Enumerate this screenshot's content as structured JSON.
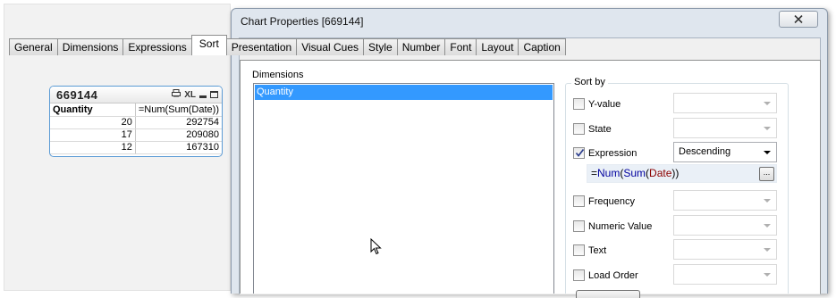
{
  "sheet": {
    "tablebox": {
      "title": "669144",
      "icons": [
        "print-icon",
        "xl-export-icon",
        "minimize-icon",
        "restore-icon"
      ],
      "xl_label": "XL",
      "columns": [
        "Quantity",
        "=Num(Sum(Date))"
      ],
      "rows": [
        [
          "20",
          "292754"
        ],
        [
          "17",
          "209080"
        ],
        [
          "12",
          "167310"
        ]
      ]
    }
  },
  "dialog": {
    "title": "Chart Properties [669144]",
    "close_icon": "close-icon",
    "tabs": [
      {
        "label": "General",
        "active": false
      },
      {
        "label": "Dimensions",
        "active": false
      },
      {
        "label": "Expressions",
        "active": false
      },
      {
        "label": "Sort",
        "active": true
      },
      {
        "label": "Presentation",
        "active": false
      },
      {
        "label": "Visual Cues",
        "active": false
      },
      {
        "label": "Style",
        "active": false
      },
      {
        "label": "Number",
        "active": false
      },
      {
        "label": "Font",
        "active": false
      },
      {
        "label": "Layout",
        "active": false
      },
      {
        "label": "Caption",
        "active": false
      }
    ],
    "dimensions_label": "Dimensions",
    "dimensions": [
      "Quantity"
    ],
    "sort_by_label": "Sort by",
    "sort_options": [
      {
        "label": "Y-value",
        "checked": false,
        "value": ""
      },
      {
        "label": "State",
        "checked": false,
        "value": ""
      },
      {
        "label": "Expression",
        "checked": true,
        "value": "Descending"
      },
      {
        "label": "Frequency",
        "checked": false,
        "value": ""
      },
      {
        "label": "Numeric Value",
        "checked": false,
        "value": ""
      },
      {
        "label": "Text",
        "checked": false,
        "value": ""
      },
      {
        "label": "Load Order",
        "checked": false,
        "value": ""
      }
    ],
    "expression": {
      "eq": "=",
      "fn1": "Num",
      "open1": "(",
      "fn2": "Sum",
      "open2": "(",
      "field": "Date",
      "close": "))"
    },
    "ellipsis_label": "..."
  },
  "colors": {
    "selection": "#3399ff",
    "tablebox_border": "#5b9bd5",
    "dialog_frame": "#dfe6ee"
  }
}
